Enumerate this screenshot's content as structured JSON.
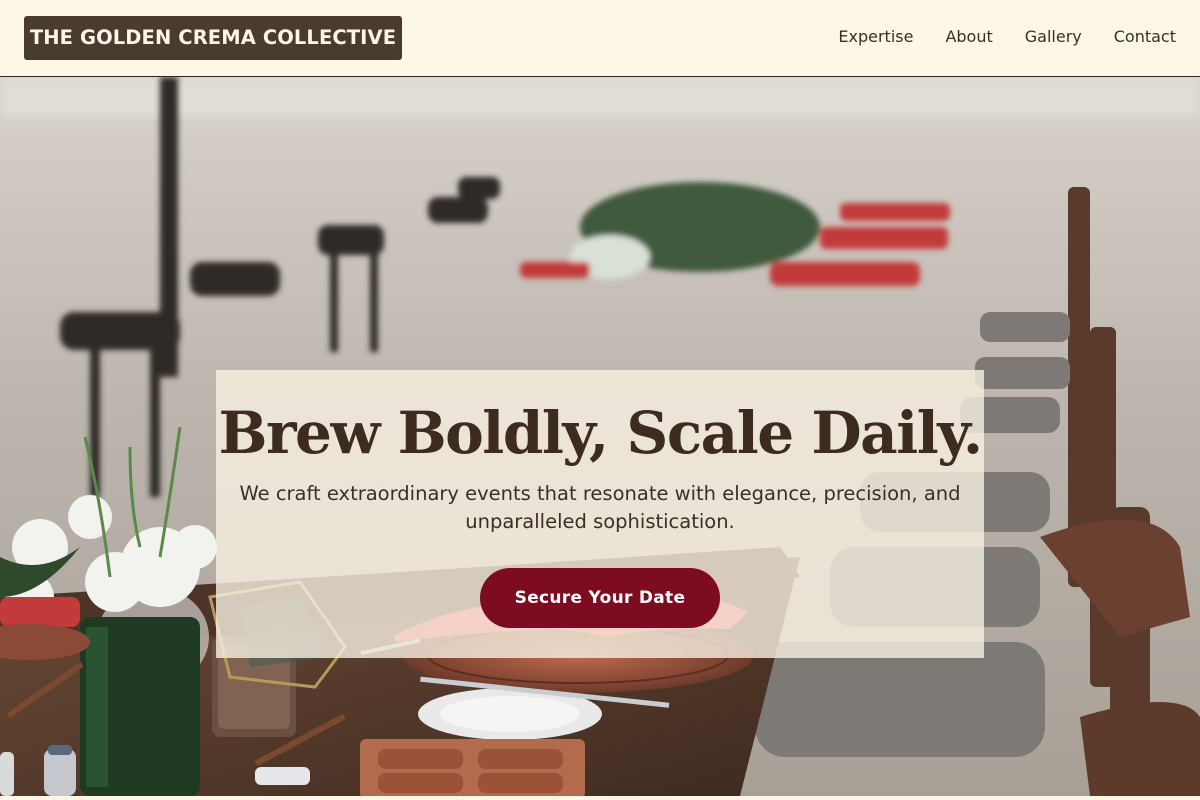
{
  "header": {
    "brand": "THE GOLDEN CREMA COLLECTIVE",
    "nav": [
      "Expertise",
      "About",
      "Gallery",
      "Contact"
    ]
  },
  "hero": {
    "title": "Brew Boldly, Scale Daily.",
    "subtitle": "We craft extraordinary events that resonate with elegance, precision, and unparalleled sophistication.",
    "cta_label": "Secure Your Date",
    "background_image": "outdoor-dining-table-photo"
  },
  "colors": {
    "brand_bg": "#4a3b30",
    "header_bg": "#fdf7e7",
    "cta": "#7d0c22",
    "title": "#3d2b21"
  }
}
